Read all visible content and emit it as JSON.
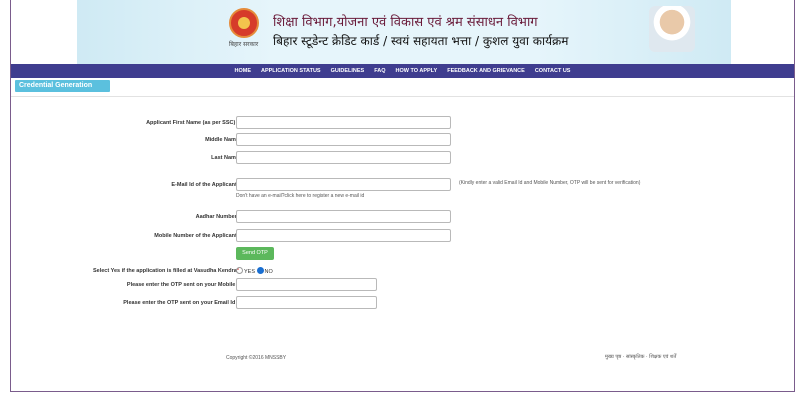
{
  "header": {
    "emblem_caption": "बिहार सरकार",
    "title_line1": "शिक्षा विभाग,योजना एवं विकास एवं श्रम संसाधन विभाग",
    "title_line2": "बिहार स्टूडेन्ट क्रेडिट कार्ड / स्वयं सहायता भत्ता / कुशल युवा कार्यक्रम"
  },
  "nav": {
    "items": [
      "HOME",
      "APPLICATION STATUS",
      "GUIDELINES",
      "FAQ",
      "HOW TO APPLY",
      "FEEDBACK AND GRIEVANCE",
      "CONTACT US"
    ]
  },
  "section": {
    "title": "Credential Generation"
  },
  "form": {
    "first_name_label": "Applicant First Name (as per SSC)",
    "middle_name_label": "Middle Name",
    "last_name_label": "Last Name",
    "email_label": "E-Mail Id of the Applicant",
    "email_hint": "(Kindly enter a valid Email Id and Mobile Number, OTP will be sent for verification)",
    "email_register_note": "Don't have an e-mail?click here to register a new e-mail id",
    "aadhar_label": "Aadhar Number",
    "mobile_label": "Mobile Number of the Applicant",
    "send_otp_label": "Send OTP",
    "vasudha_label": "Select Yes if the application is filled at Vasudha Kendra",
    "vasudha_yes": "YES",
    "vasudha_no": "NO",
    "vasudha_selected": "NO",
    "otp_mobile_label": "Please enter the OTP sent on your Mobile",
    "otp_email_label": "Please enter the OTP sent on your Email Id",
    "required_mark": "*"
  },
  "footer": {
    "copyright": "Copyright ©2016 MNSSBY",
    "links": "मुख्य पृष्ठ · सांस्कृतिक · शिक्षक एवं शर्तें"
  }
}
